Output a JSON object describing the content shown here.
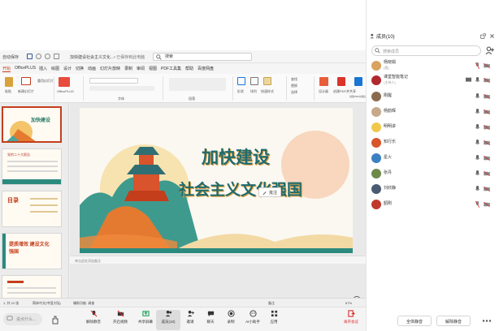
{
  "meeting": {
    "colors": {
      "accent": "#1a73e8",
      "end": "#e02a2a",
      "ppt_accent": "#c43e1c"
    }
  },
  "powerpoint": {
    "autosave_label": "自动保存",
    "document_title": "加快建设社会主义文化...",
    "saved_status": "• 已保存到此电脑",
    "search_placeholder": "搜索",
    "tabs": [
      "开始",
      "OfficePLUS",
      "插入",
      "绘图",
      "设计",
      "切换",
      "动画",
      "幻灯片放映",
      "录制",
      "审阅",
      "视图",
      "PDF工具集",
      "帮助",
      "百度网盘"
    ],
    "ribbon_labels": [
      "粘贴",
      "新建幻灯片",
      "重用幻灯片",
      "OfficePLUS",
      "字体",
      "段落",
      "形状",
      "排列",
      "快速样式",
      "查找",
      "替换",
      "选择",
      "设计器",
      "创建PDF并共享",
      "创建PDF并通过Outlook共享"
    ],
    "slide": {
      "title": "加快建设",
      "subtitle": "社会主义文化强国"
    },
    "thumbnails": [
      "加快建设",
      "党的二十大报告",
      "目录",
      "提质增效 建设文化强国",
      ""
    ],
    "notes_placeholder": "单击此处添加备注",
    "status": {
      "slide_count": "1, 共 24 张",
      "language": "简体中文(中国大陆)",
      "accessibility": "辅助功能: 调查",
      "notes": "备注",
      "zoom": "67%"
    },
    "annotate_label": "批注"
  },
  "toolbar": {
    "chat_placeholder": "说点什么...",
    "buttons": [
      {
        "label": "解除静音",
        "icon": "mic-muted-icon"
      },
      {
        "label": "开启视频",
        "icon": "camera-off-icon"
      },
      {
        "label": "共享屏幕",
        "icon": "share-screen-icon"
      },
      {
        "label": "成员(10)",
        "icon": "members-icon"
      },
      {
        "label": "邀请",
        "icon": "invite-icon"
      },
      {
        "label": "聊天",
        "icon": "chat-icon"
      },
      {
        "label": "录制",
        "icon": "record-icon"
      },
      {
        "label": "AI小助手",
        "icon": "ai-assistant-icon"
      },
      {
        "label": "应用",
        "icon": "apps-icon"
      }
    ],
    "end_label": "离开会议"
  },
  "panel": {
    "title": "成员(10)",
    "search_placeholder": "搜索成员",
    "members": [
      {
        "name": "杨晓娟",
        "sub": "(我)",
        "color": "#d9a25f"
      },
      {
        "name": "课堂智能笔记",
        "sub": "(主持人)",
        "color": "#b0292f"
      },
      {
        "name": "刚醒",
        "sub": "",
        "color": "#8a6b4e"
      },
      {
        "name": "杨韵辉",
        "sub": "",
        "color": "#c7a98a"
      },
      {
        "name": "明明讲",
        "sub": "",
        "color": "#f1c84b"
      },
      {
        "name": "知行乐",
        "sub": "",
        "color": "#d8552c"
      },
      {
        "name": "星火",
        "sub": "",
        "color": "#3c7fc2"
      },
      {
        "name": "张丹",
        "sub": "",
        "color": "#6d8a4a"
      },
      {
        "name": "刘欣静",
        "sub": "",
        "color": "#4a5a73"
      },
      {
        "name": "韶刚",
        "sub": "",
        "color": "#c0392b"
      }
    ],
    "footer": {
      "mute_all": "全体静音",
      "unmute_all": "解除静音"
    }
  }
}
